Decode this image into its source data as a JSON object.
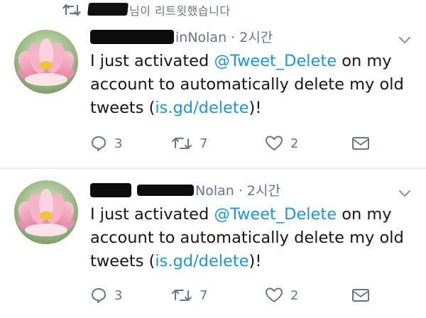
{
  "retweet_context": {
    "icon": "retweet-icon",
    "text": "님이 리트윗했습니다"
  },
  "tweets": [
    {
      "handle_suffix": "inNolan",
      "time": " · 2시간",
      "text_before": "I just activated ",
      "mention": "@Tweet_Delete",
      "text_middle": " on my account to automatically delete my old tweets (",
      "link": "is.gd/delete",
      "text_after": ")!",
      "replies": "3",
      "retweets": "7",
      "likes": "2"
    },
    {
      "handle_suffix": "Nolan",
      "time": " · 2시간",
      "text_before": "I just activated ",
      "mention": "@Tweet_Delete",
      "text_middle": " on my account to automatically delete my old tweets (",
      "link": "is.gd/delete",
      "text_after": ")!",
      "replies": "3",
      "retweets": "7",
      "likes": "2"
    }
  ],
  "colors": {
    "link": "#1b95e0",
    "muted": "#657786",
    "text": "#14171a",
    "divider": "#e6ecf0"
  }
}
